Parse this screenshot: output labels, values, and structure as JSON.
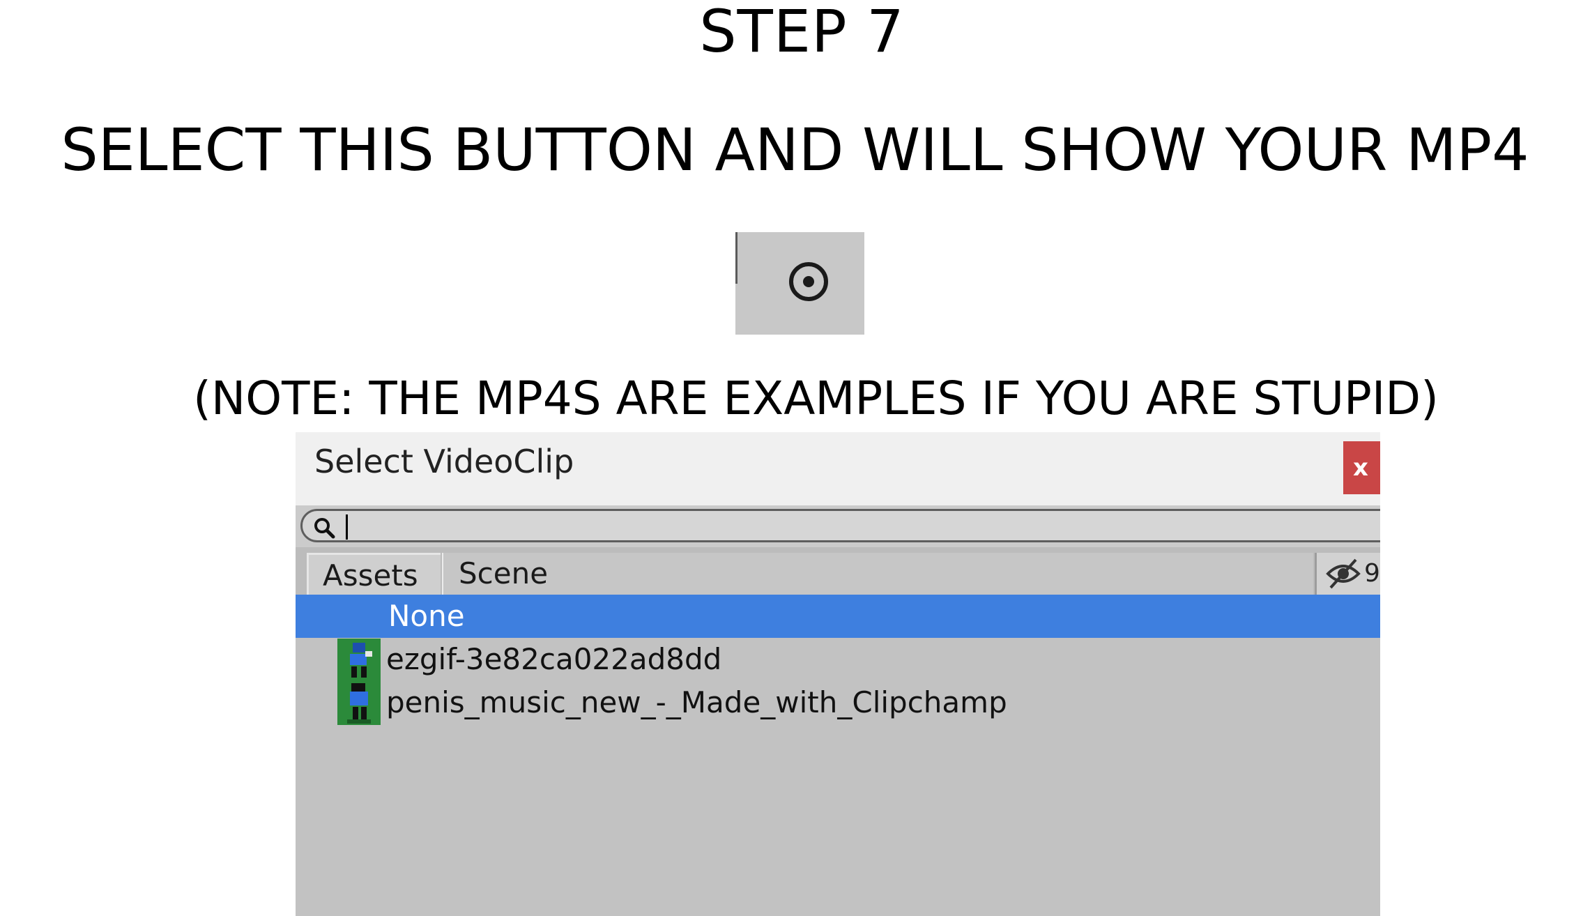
{
  "captions": {
    "step": "STEP 7",
    "instruction": "SELECT THIS BUTTON AND WILL SHOW YOUR MP4",
    "note": "(NOTE: THE MP4S ARE EXAMPLES IF YOU ARE STUPID)"
  },
  "picker_button": {
    "icon": "object-picker-target-icon"
  },
  "window": {
    "title": "Select VideoClip",
    "close_label": "x",
    "search": {
      "value": "",
      "placeholder": ""
    },
    "tabs": [
      {
        "label": "Assets",
        "active": true
      },
      {
        "label": "Scene",
        "active": false
      }
    ],
    "visibility_toggle": {
      "icon": "eye-slash-icon",
      "count": "9"
    },
    "items": [
      {
        "label": "None",
        "selected": true,
        "icon": ""
      },
      {
        "label": "ezgif-3e82ca022ad8dd",
        "selected": false,
        "icon": "video-clip-icon"
      },
      {
        "label": "penis_music_new_-_Made_with_Clipchamp",
        "selected": false,
        "icon": "video-clip-icon"
      }
    ]
  },
  "colors": {
    "selection": "#3e7fdf",
    "close_button": "#c94646",
    "window_background": "#c2c2c2",
    "clip_icon_background": "#2b8a3a"
  }
}
